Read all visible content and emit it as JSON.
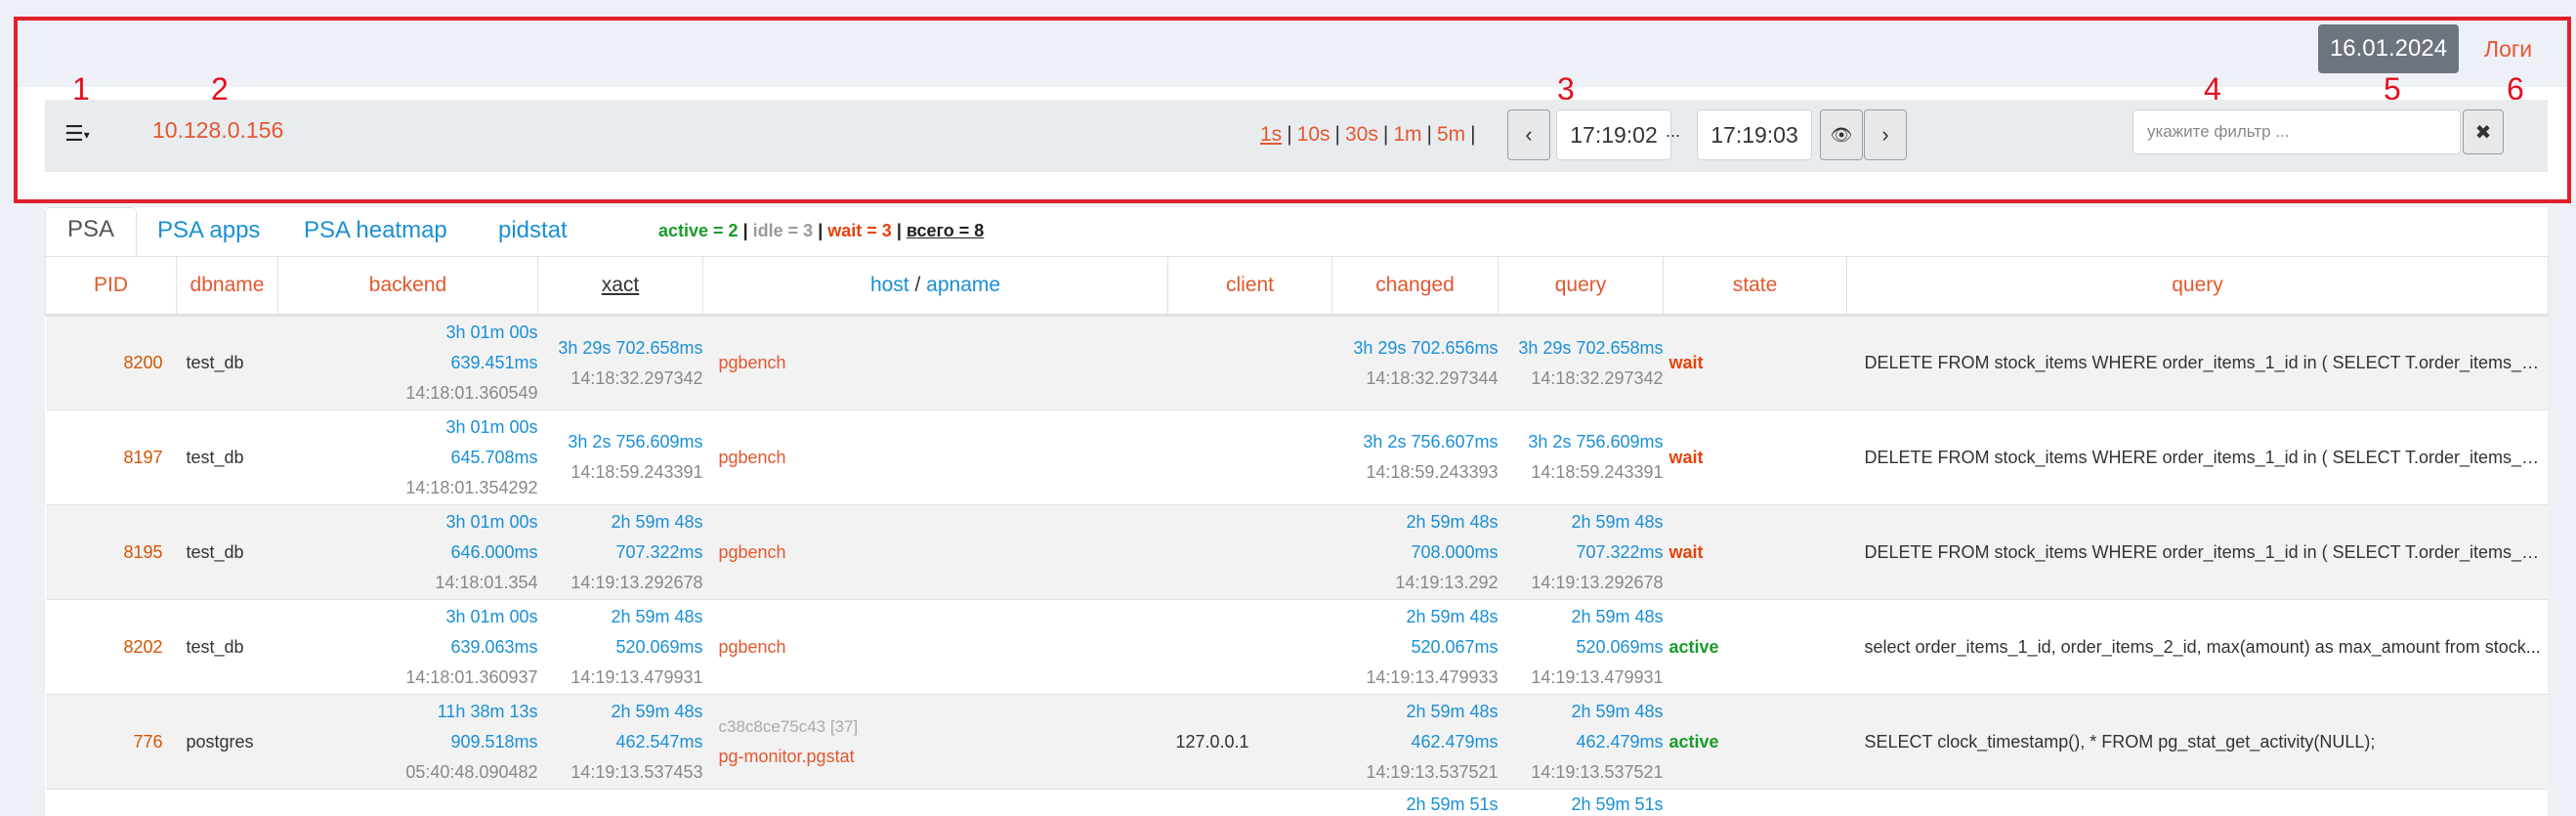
{
  "header": {
    "date": "16.01.2024",
    "logs_label": "Логи",
    "markers": [
      "1",
      "2",
      "3",
      "4",
      "5",
      "6"
    ],
    "menu_icon": "list-icon",
    "server_ip": "10.128.0.156",
    "intervals": [
      "1s",
      "10s",
      "30s",
      "1m",
      "5m"
    ],
    "time_from": "17:19:02",
    "time_separator": "...",
    "time_to": "17:19:03",
    "prev_icon": "chevron-left-icon",
    "next_icon": "chevron-right-icon",
    "view_icon": "eye-icon",
    "filter_placeholder": "укажите фильтр ...",
    "clear_icon": "close-icon"
  },
  "tabs": [
    "PSA",
    "PSA apps",
    "PSA heatmap",
    "pidstat"
  ],
  "counts": {
    "active": "active = 2",
    "idle": "idle = 3",
    "wait": "wait = 3",
    "total": "всего = 8",
    "sep": "|"
  },
  "columns": {
    "pid": "PID",
    "dbname": "dbname",
    "backend": "backend",
    "xact": "xact",
    "host": "host",
    "host_sep": "/",
    "apname": "apname",
    "client": "client",
    "changed": "changed",
    "query_time": "query",
    "state": "state",
    "query": "query"
  },
  "rows": [
    {
      "pid": "8200",
      "dbname": "test_db",
      "backend": [
        "3h 01m 00s",
        "639.451ms",
        "14:18:01.360549"
      ],
      "xact": [
        "3h 29s 702.658ms",
        "14:18:32.297342"
      ],
      "host_id": "",
      "apname": "pgbench",
      "client": "",
      "changed": [
        "3h 29s 702.656ms",
        "14:18:32.297344"
      ],
      "qtime": [
        "3h 29s 702.658ms",
        "14:18:32.297342"
      ],
      "state": "wait",
      "query": "DELETE FROM stock_items WHERE order_items_1_id in ( SELECT T.order_items_1_id ..."
    },
    {
      "pid": "8197",
      "dbname": "test_db",
      "backend": [
        "3h 01m 00s",
        "645.708ms",
        "14:18:01.354292"
      ],
      "xact": [
        "3h 2s 756.609ms",
        "14:18:59.243391"
      ],
      "host_id": "",
      "apname": "pgbench",
      "client": "",
      "changed": [
        "3h 2s 756.607ms",
        "14:18:59.243393"
      ],
      "qtime": [
        "3h 2s 756.609ms",
        "14:18:59.243391"
      ],
      "state": "wait",
      "query": "DELETE FROM stock_items WHERE order_items_1_id in ( SELECT T.order_items_1_id ..."
    },
    {
      "pid": "8195",
      "dbname": "test_db",
      "backend": [
        "3h 01m 00s",
        "646.000ms",
        "14:18:01.354"
      ],
      "xact": [
        "2h 59m 48s",
        "707.322ms",
        "14:19:13.292678"
      ],
      "host_id": "",
      "apname": "pgbench",
      "client": "",
      "changed": [
        "2h 59m 48s",
        "708.000ms",
        "14:19:13.292"
      ],
      "qtime": [
        "2h 59m 48s",
        "707.322ms",
        "14:19:13.292678"
      ],
      "state": "wait",
      "query": "DELETE FROM stock_items WHERE order_items_1_id in ( SELECT T.order_items_1_id ..."
    },
    {
      "pid": "8202",
      "dbname": "test_db",
      "backend": [
        "3h 01m 00s",
        "639.063ms",
        "14:18:01.360937"
      ],
      "xact": [
        "2h 59m 48s",
        "520.069ms",
        "14:19:13.479931"
      ],
      "host_id": "",
      "apname": "pgbench",
      "client": "",
      "changed": [
        "2h 59m 48s",
        "520.067ms",
        "14:19:13.479933"
      ],
      "qtime": [
        "2h 59m 48s",
        "520.069ms",
        "14:19:13.479931"
      ],
      "state": "active",
      "query": "select order_items_1_id, order_items_2_id, max(amount) as max_amount from stock..."
    },
    {
      "pid": "776",
      "dbname": "postgres",
      "backend": [
        "11h 38m 13s",
        "909.518ms",
        "05:40:48.090482"
      ],
      "xact": [
        "2h 59m 48s",
        "462.547ms",
        "14:19:13.537453"
      ],
      "host_id": "c38c8ce75c43 [37]",
      "apname": "pg-monitor.pgstat",
      "client": "127.0.0.1",
      "changed": [
        "2h 59m 48s",
        "462.479ms",
        "14:19:13.537521"
      ],
      "qtime": [
        "2h 59m 48s",
        "462.479ms",
        "14:19:13.537521"
      ],
      "state": "active",
      "query": "SELECT clock_timestamp(), * FROM pg_stat_get_activity(NULL);"
    },
    {
      "pid": "",
      "dbname": "",
      "backend": [],
      "xact": [],
      "host_id": "",
      "apname": "",
      "client": "",
      "changed": [
        "2h 59m 51s"
      ],
      "qtime": [
        "2h 59m 51s"
      ],
      "state": "",
      "query": ""
    }
  ]
}
